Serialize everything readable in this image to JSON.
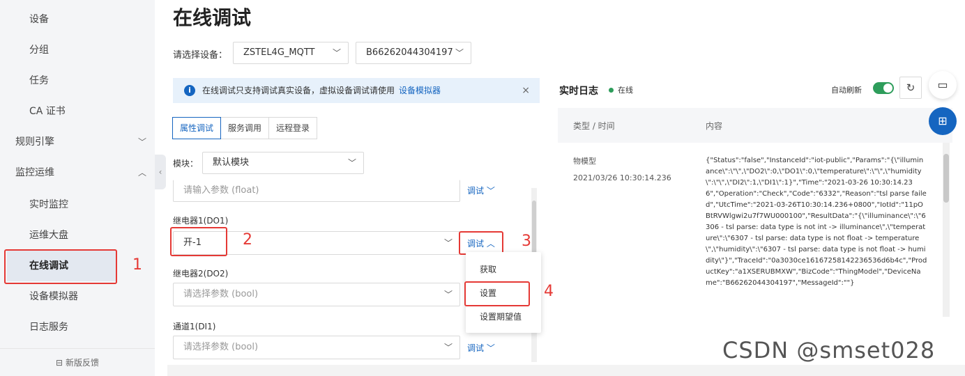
{
  "sidebar": {
    "items": [
      {
        "label": "设备",
        "type": "sub"
      },
      {
        "label": "分组",
        "type": "sub"
      },
      {
        "label": "任务",
        "type": "sub"
      },
      {
        "label": "CA 证书",
        "type": "sub"
      },
      {
        "label": "规则引擎",
        "type": "group",
        "chevron": "chevron-down"
      },
      {
        "label": "监控运维",
        "type": "group",
        "chevron": "chevron-up"
      },
      {
        "label": "实时监控",
        "type": "sub"
      },
      {
        "label": "运维大盘",
        "type": "sub"
      },
      {
        "label": "在线调试",
        "type": "sub",
        "active": true
      },
      {
        "label": "设备模拟器",
        "type": "sub"
      },
      {
        "label": "日志服务",
        "type": "sub"
      }
    ],
    "feedback": "新版反馈"
  },
  "main": {
    "title": "在线调试",
    "device_label": "请选择设备：",
    "product_select": "ZSTEL4G_MQTT",
    "device_select": "B66262044304197",
    "info": {
      "text": "在线调试只支持调试真实设备，虚拟设备调试请使用",
      "link": "设备模拟器",
      "close": "×"
    },
    "tabs": [
      "属性调试",
      "服务调用",
      "远程登录"
    ],
    "module_label": "模块：",
    "module_select": "默认模块",
    "fields": {
      "first_placeholder": "请输入参数 (float)",
      "relay1_label": "继电器1(DO1)",
      "relay1_value": "开-1",
      "relay2_label": "继电器2(DO2)",
      "relay2_placeholder": "请选择参数 (bool)",
      "channel1_label": "通道1(DI1)",
      "channel1_placeholder": "请选择参数 (bool)"
    },
    "debug_label": "调试",
    "dropdown": [
      "获取",
      "设置",
      "设置期望值"
    ]
  },
  "log": {
    "title": "实时日志",
    "status": "在线",
    "auto_refresh": "自动刷新",
    "col_type": "类型 / 时间",
    "col_content": "内容",
    "row": {
      "type": "物模型",
      "time": "2021/03/26 10:30:14.236",
      "content": "{\"Status\":\"false\",\"InstanceId\":\"iot-public\",\"Params\":\"{\\\"illuminance\\\":\\\"\\\",\\\"DO2\\\":0,\\\"DO1\\\":0,\\\"temperature\\\":\\\"\\\",\\\"humidity\\\":\\\"\\\",\\\"DI2\\\":1,\\\"DI1\\\":1}\",\"Time\":\"2021-03-26 10:30:14.236\",\"Operation\":\"Check\",\"Code\":\"6332\",\"Reason\":\"tsl parse failed\",\"UtcTime\":\"2021-03-26T10:30:14.236+0800\",\"IotId\":\"11pOBtRVWlgwi2u7f7WU000100\",\"ResultData\":\"{\\\"illuminance\\\":\\\"6306 - tsl parse: data type is not int -> illuminance\\\",\\\"temperature\\\":\\\"6307 - tsl parse: data type is not float -> temperature\\\",\\\"humidity\\\":\\\"6307 - tsl parse: data type is not float -> humidity\\\"}\",\"TraceId\":\"0a3030ce16167258142236536d6b4c\",\"ProductKey\":\"a1XSERUBMXW\",\"BizCode\":\"ThingModel\",\"DeviceName\":\"B66262044304197\",\"MessageId\":\"\"}"
    }
  },
  "annotations": [
    "1",
    "2",
    "3",
    "4"
  ],
  "watermark": "CSDN @smset028",
  "colors": {
    "accent": "#1565c0",
    "online": "#2e9d5b",
    "annotation": "#e53935"
  }
}
